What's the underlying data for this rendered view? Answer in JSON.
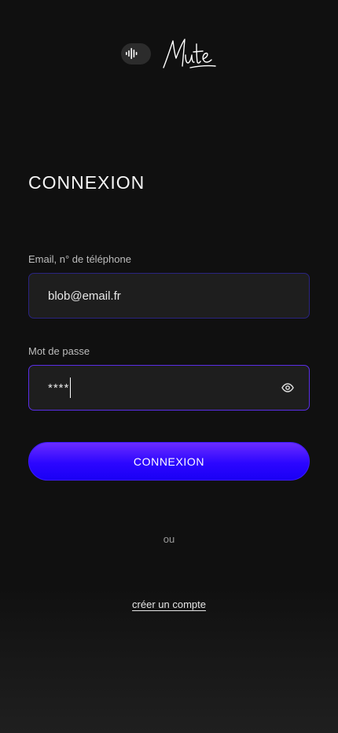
{
  "header": {
    "logo_icon": "sound-wave-icon",
    "brand_name": "Mute"
  },
  "login": {
    "title": "CONNEXION",
    "email_label": "Email, n° de téléphone",
    "email_value": "blob@email.fr",
    "password_label": "Mot de passe",
    "password_value": "****",
    "password_toggle_icon": "eye-icon",
    "submit_label": "CONNEXION",
    "separator": "ou",
    "create_account_label": "créer un compte"
  },
  "colors": {
    "background": "#101010",
    "field_background": "#1e1e1e",
    "accent": "#2c06ff",
    "accent_light": "#6a2cff"
  }
}
